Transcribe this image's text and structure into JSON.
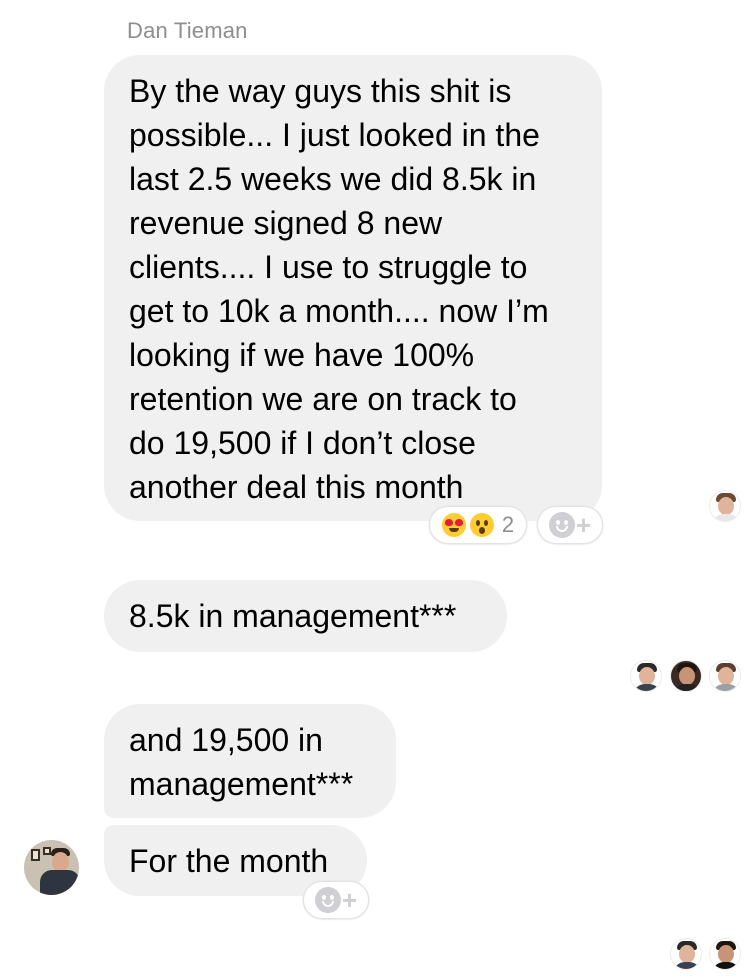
{
  "chat": {
    "sender_name": "Dan Tieman",
    "messages": [
      {
        "lines": [
          "By the way guys this shit is",
          "possible... I just looked in the",
          "last 2.5 weeks we did 8.5k in",
          "revenue signed 8 new",
          "clients.... I use to struggle to",
          "get to 10k a month.... now I’m",
          "looking if we have 100%",
          "retention we are on track to",
          "do 19,500 if I don’t close",
          "another deal this month"
        ],
        "reactions": {
          "emojis": [
            "heart-eyes",
            "wow"
          ],
          "count": "2"
        }
      },
      {
        "lines": [
          "8.5k in management***"
        ]
      },
      {
        "lines": [
          "and 19,500 in",
          "management***"
        ]
      },
      {
        "lines": [
          "For the month"
        ]
      }
    ],
    "add_reaction_plus": "+"
  },
  "read_receipts": {
    "after_message_1": [
      "participant-avatar"
    ],
    "after_message_2": [
      "participant-avatar",
      "participant-avatar",
      "participant-avatar"
    ],
    "after_message_4": [
      "participant-avatar",
      "participant-avatar"
    ]
  }
}
